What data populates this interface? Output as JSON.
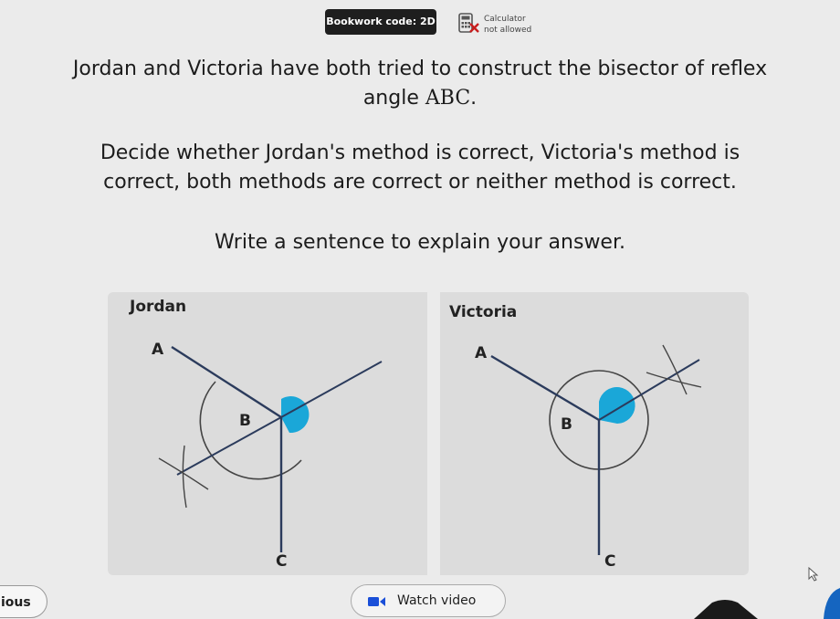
{
  "header": {
    "bookwork_label": "Bookwork code: 2D",
    "calculator_line1": "Calculator",
    "calculator_line2": "not allowed"
  },
  "question": {
    "line1_text": "Jordan and Victoria have both tried to construct the bisector of reflex",
    "line1_text2": "angle ",
    "line1_math": "ABC",
    "line1_end": ".",
    "line2_a": "Decide whether Jordan's method is correct, Victoria's method is",
    "line2_b": "correct, both methods are correct or neither method is correct.",
    "line3": "Write a sentence to explain your answer."
  },
  "diagrams": {
    "jordan": {
      "title": "Jordan",
      "label_a": "A",
      "label_b": "B",
      "label_c": "C"
    },
    "victoria": {
      "title": "Victoria",
      "label_a": "A",
      "label_b": "B",
      "label_c": "C"
    },
    "colors": {
      "angle_fill": "#1aa7d8",
      "line": "#2b3b5c",
      "arc": "#444444"
    }
  },
  "footer": {
    "previous_label": "ious",
    "watch_video_label": "Watch video"
  },
  "icons": [
    "calculator-crossed-icon",
    "video-camera-icon",
    "cursor-icon"
  ]
}
